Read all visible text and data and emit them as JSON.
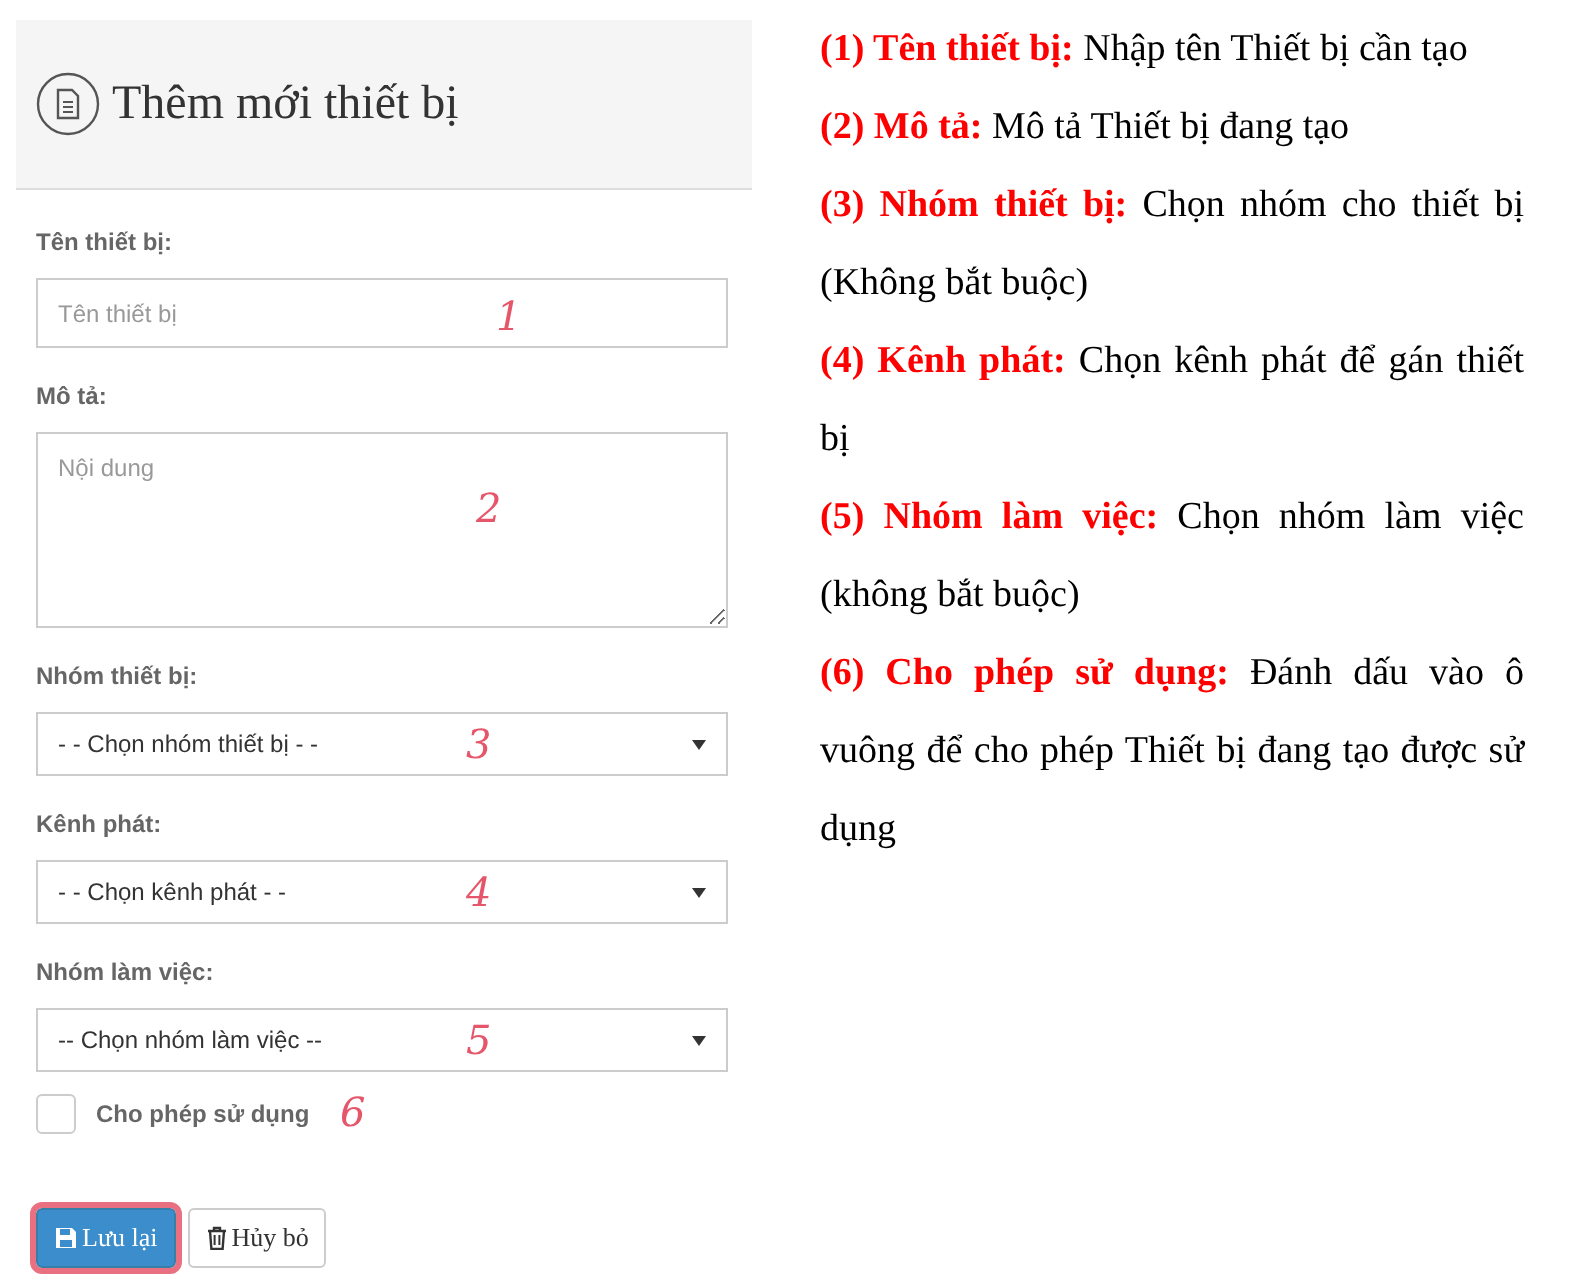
{
  "panel": {
    "title": "Thêm mới thiết bị",
    "fields": [
      {
        "kind": "text",
        "label": "Tên thiết bị:",
        "placeholder": "Tên thiết bị",
        "marker": "1"
      },
      {
        "kind": "textarea",
        "label": "Mô tả:",
        "placeholder": "Nội dung",
        "marker": "2"
      },
      {
        "kind": "select",
        "label": "Nhóm thiết bị:",
        "value": "- - Chọn nhóm thiết bị - -",
        "marker": "3"
      },
      {
        "kind": "select",
        "label": "Kênh phát:",
        "value": "- - Chọn kênh phát - -",
        "marker": "4"
      },
      {
        "kind": "select",
        "label": "Nhóm làm việc:",
        "value": "-- Chọn nhóm làm việc --",
        "marker": "5"
      }
    ],
    "checkbox": {
      "label": "Cho phép sử dụng",
      "checked": false,
      "marker": "6"
    },
    "buttons": [
      {
        "kind": "save",
        "label": "Lưu lại",
        "highlighted": true
      },
      {
        "kind": "cancel",
        "label": "Hủy bỏ",
        "highlighted": false
      }
    ]
  },
  "notes": [
    {
      "label": "(1) Tên thiết bị:",
      "text": "Nhập tên Thiết bị cần tạo"
    },
    {
      "label": "(2) Mô tả:",
      "text": "Mô tả Thiết bị đang tạo"
    },
    {
      "label": "(3) Nhóm thiết bị:",
      "text": "Chọn nhóm cho thiết bị (Không bắt buộc)"
    },
    {
      "label": "(4) Kênh phát:",
      "text": "Chọn kênh phát để gán thiết bị"
    },
    {
      "label": "(5) Nhóm làm việc:",
      "text": "Chọn nhóm làm việc (không bắt buộc)"
    },
    {
      "label": "(6) Cho phép sử dụng:",
      "text": "Đánh dấu vào ô vuông để cho phép Thiết bị đang tạo được sử dụng"
    }
  ]
}
